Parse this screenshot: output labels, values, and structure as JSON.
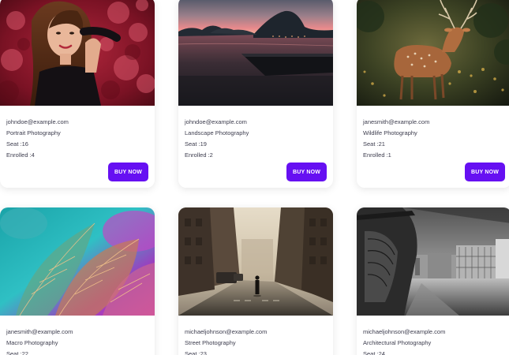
{
  "cards": [
    {
      "image_alt": "portrait-photo",
      "email": "johndoe@example.com",
      "category": "Portrait Photography",
      "seat": "Seat :16",
      "enrolled": "Enrolled :4",
      "button_label": "BUY NOW"
    },
    {
      "image_alt": "landscape-photo",
      "email": "johndoe@example.com",
      "category": "Landscape Photography",
      "seat": "Seat :19",
      "enrolled": "Enrolled :2",
      "button_label": "BUY NOW"
    },
    {
      "image_alt": "wildlife-photo",
      "email": "janesmith@example.com",
      "category": "Wildlife Photography",
      "seat": "Seat :21",
      "enrolled": "Enrolled :1",
      "button_label": "BUY NOW"
    },
    {
      "image_alt": "macro-photo",
      "email": "janesmith@example.com",
      "category": "Macro Photography",
      "seat": "Seat :22"
    },
    {
      "image_alt": "street-photo",
      "email": "michaeljohnson@example.com",
      "category": "Street Photography",
      "seat": "Seat :23"
    },
    {
      "image_alt": "architecture-photo",
      "email": "michaeljohnson@example.com",
      "category": "Architectural Photography",
      "seat": "Seat :24"
    }
  ],
  "colors": {
    "accent": "#6610f2",
    "text": "#3d3d4e",
    "card_bg": "#ffffff"
  }
}
